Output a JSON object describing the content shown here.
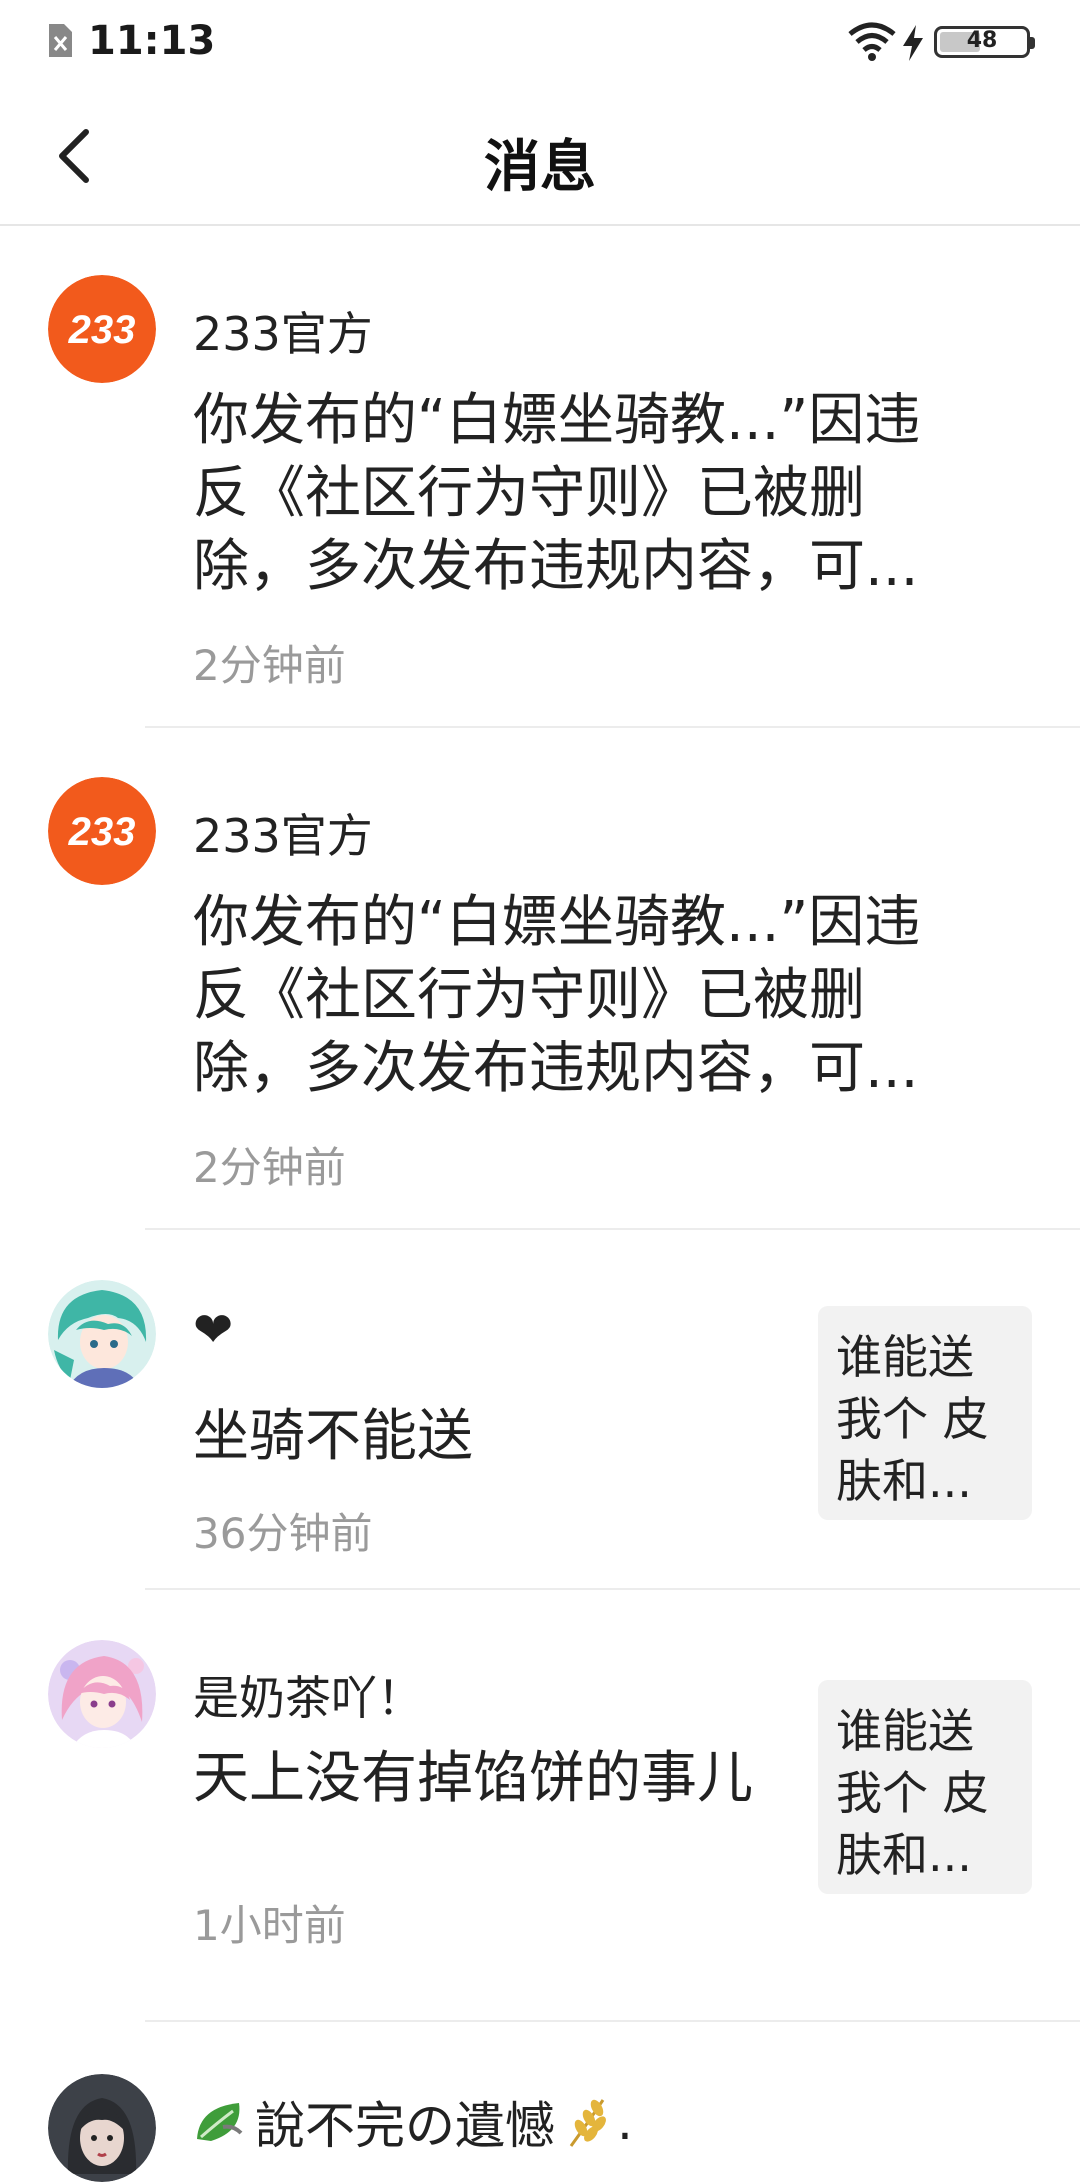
{
  "status_bar": {
    "time": "11:13",
    "battery": "48",
    "battery_percent": 48,
    "icons": [
      "sim-blocked-icon",
      "wifi-icon",
      "charging-bolt-icon",
      "battery-icon"
    ]
  },
  "header": {
    "title": "消息",
    "back_icon": "chevron-left-icon"
  },
  "messages": [
    {
      "name": "233官方",
      "avatar": "233-logo",
      "content": "你发布的“白嫖坐骑教...”因违反《社区行为守则》已被删除，多次发布违规内容，可...",
      "time": "2分钟前"
    },
    {
      "name": "233官方",
      "avatar": "233-logo",
      "content": "你发布的“白嫖坐骑教...”因违反《社区行为守则》已被删除，多次发布违规内容，可...",
      "time": "2分钟前"
    },
    {
      "name": "❤",
      "avatar": "anime-green-hair-avatar",
      "content": "坐骑不能送",
      "time": "36分钟前",
      "thumb_text": "谁能送我个 皮肤和..."
    },
    {
      "name": "是奶茶吖！",
      "avatar": "anime-pink-hair-avatar",
      "content": "天上没有掉馅饼的事儿",
      "time": "1小时前",
      "thumb_text": "谁能送我个 皮肤和..."
    },
    {
      "name": "說不完の遺憾",
      "name_prefix_icon": "leaf-icon",
      "name_suffix_icon": "wheat-icon",
      "name_suffix_text": ".",
      "avatar": "dark-hair-girl-avatar"
    }
  ],
  "colors": {
    "brand_orange": "#f25a1c",
    "divider": "#ececec",
    "time_gray": "#9a9a9a"
  }
}
